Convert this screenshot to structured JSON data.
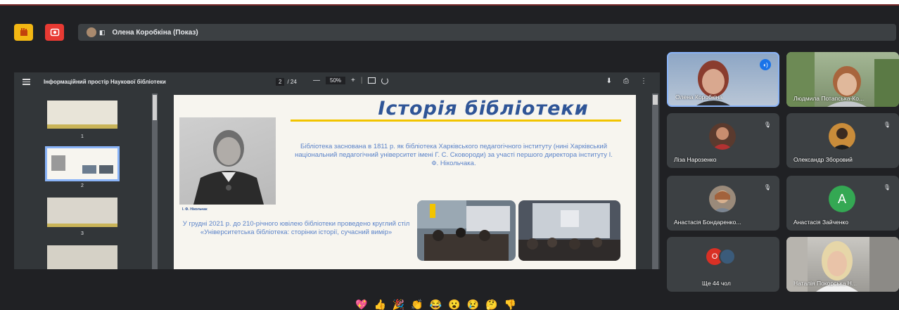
{
  "colors": {
    "background": "#202124",
    "raise_hand": "#f3b713",
    "recording": "#e83a33",
    "slide_title": "#2f5597",
    "slide_accent": "#f2c400",
    "active_speaker_border": "#8ab4f8"
  },
  "top_bar": {
    "presenter_label": "Олена Коробкіна (Показ)"
  },
  "pdf_viewer": {
    "document_title": "Інформаційний простір Наукової бібліотеки",
    "page_current": "2",
    "page_total": "/ 24",
    "zoom_minus": "—",
    "zoom_value": "50%",
    "zoom_plus": "+",
    "thumbnail_numbers": [
      "1",
      "2",
      "3"
    ]
  },
  "slide": {
    "title": "Історія бібліотеки",
    "paragraph_1": "Бібліотека заснована в 1811 р. як бібліотека Харківського педагогічного інституту (нині Харківський національний педагогічний університет імені Г. С. Сковороди) за участі першого директора інституту І. Ф. Нікольчака.",
    "paragraph_2": "У грудні 2021 р. до 210-річного ювілею бібліотеки проведено круглий стіл «Університетська бібліотека: сторінки історії, сучасний вимір»",
    "portrait_caption": "І. Ф. Нікольчак"
  },
  "participants": [
    {
      "name": "Олена Коробкіна",
      "speaking": true
    },
    {
      "name": "Людмила Потапська-Ко...",
      "speaking": false
    },
    {
      "name": "Ліза Нарозенко",
      "speaking": false
    },
    {
      "name": "Олександр Зборовий",
      "speaking": false
    },
    {
      "name": "Анастасія Бондаренко...",
      "speaking": false
    },
    {
      "name": "Анастасія Зайченко",
      "speaking": false,
      "avatar_letter": "A"
    },
    {
      "name": "Ще 44 чол",
      "speaking": false,
      "overflow_letter": "О"
    },
    {
      "name": "Наталія Покорська Н...",
      "speaking": false
    }
  ],
  "reactions": [
    "💖",
    "👍",
    "🎉",
    "👏",
    "😂",
    "😮",
    "😢",
    "🤔",
    "👎"
  ]
}
